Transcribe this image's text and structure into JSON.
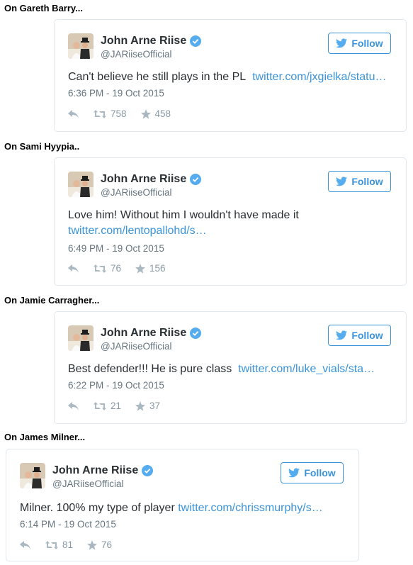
{
  "tweets": [
    {
      "section": "On Gareth Barry...",
      "name": "John Arne Riise",
      "handle": "@JARiiseOfficial",
      "follow": "Follow",
      "text": "Can't believe he still plays in the PL",
      "link": "twitter.com/jxgielka/statu…",
      "time": "6:36 PM - 19 Oct 2015",
      "retweets": "758",
      "likes": "458"
    },
    {
      "section": "On Sami Hyypia..",
      "name": "John Arne Riise",
      "handle": "@JARiiseOfficial",
      "follow": "Follow",
      "text": "Love him! Without him I wouldn't have made it",
      "link": "twitter.com/lentopallohd/s…",
      "time": "6:49 PM - 19 Oct 2015",
      "retweets": "76",
      "likes": "156"
    },
    {
      "section": "On Jamie Carragher...",
      "name": "John Arne Riise",
      "handle": "@JARiiseOfficial",
      "follow": "Follow",
      "text": "Best defender!!! He is pure class",
      "link": "twitter.com/luke_vials/sta…",
      "time": "6:22 PM - 19 Oct 2015",
      "retweets": "21",
      "likes": "37"
    },
    {
      "section": "On James Milner...",
      "name": "John Arne Riise",
      "handle": "@JARiiseOfficial",
      "follow": "Follow",
      "text": "Milner. 100% my type of player",
      "link": "twitter.com/chrissmurphy/s…",
      "time": "6:14 PM - 19 Oct 2015",
      "retweets": "81",
      "likes": "76"
    }
  ],
  "colors": {
    "accent": "#3b94d9",
    "text": "#292f33",
    "muted": "#66757f",
    "border": "#e1e8ed",
    "verified": "#55acee"
  },
  "icons": [
    "avatar-photo",
    "verified-icon",
    "twitter-bird-icon",
    "reply-icon",
    "retweet-icon",
    "like-star-icon"
  ]
}
